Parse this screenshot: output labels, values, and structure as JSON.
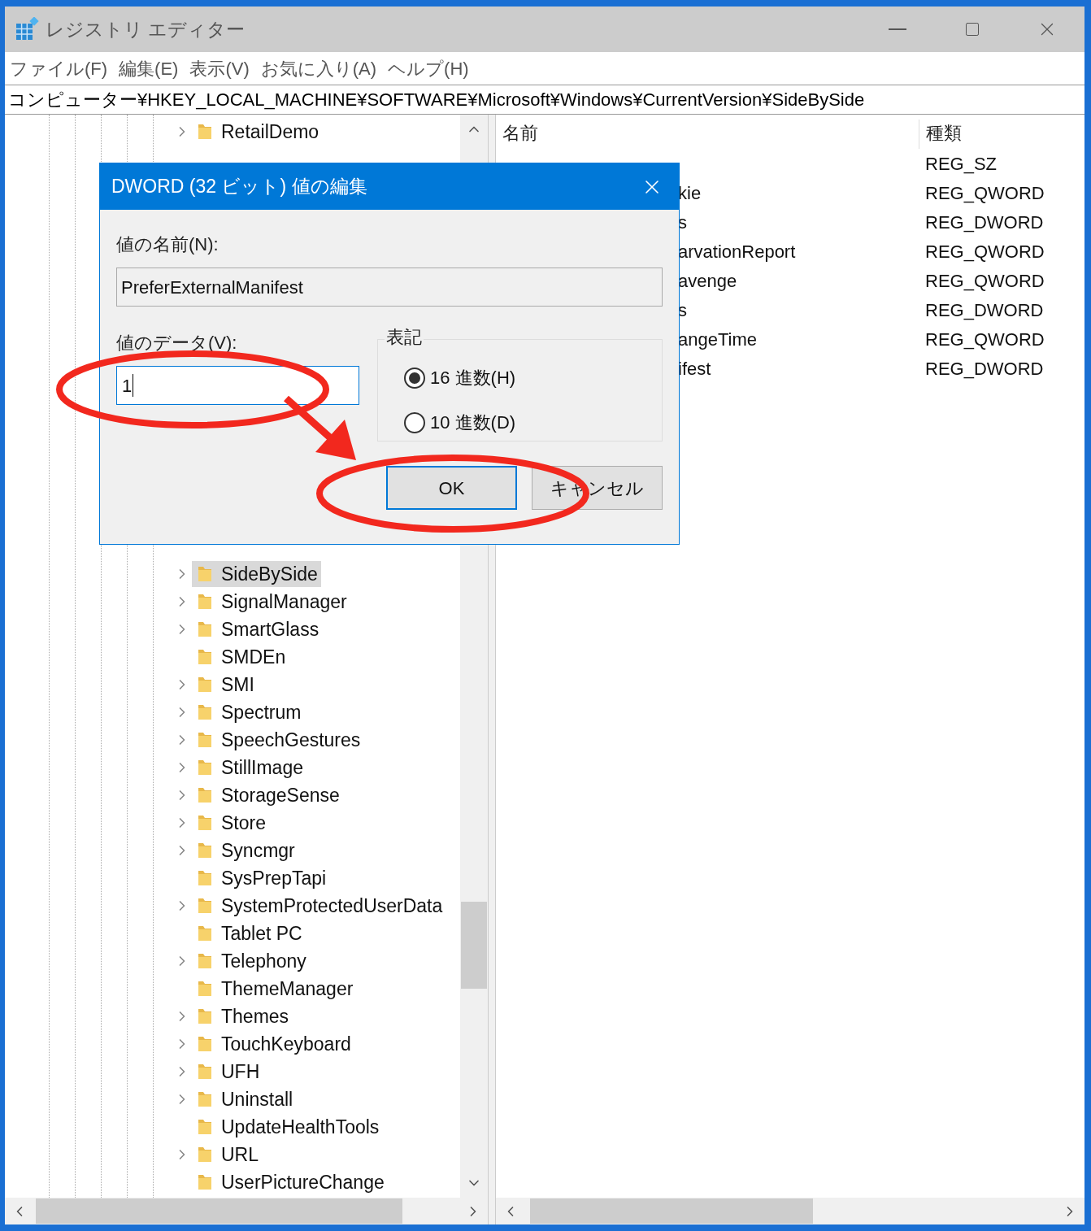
{
  "window": {
    "title": "レジストリ エディター"
  },
  "menu": [
    "ファイル(F)",
    "編集(E)",
    "表示(V)",
    "お気に入り(A)",
    "ヘルプ(H)"
  ],
  "address_bar": {
    "value": "コンピューター¥HKEY_LOCAL_MACHINE¥SOFTWARE¥Microsoft¥Windows¥CurrentVersion¥SideBySide"
  },
  "tree": {
    "items_top": [
      {
        "label": "RetailDemo",
        "expandable": true,
        "selected": false
      }
    ],
    "items_bottom": [
      {
        "label": "SideBySide",
        "expandable": true,
        "selected": true
      },
      {
        "label": "SignalManager",
        "expandable": true,
        "selected": false
      },
      {
        "label": "SmartGlass",
        "expandable": true,
        "selected": false
      },
      {
        "label": "SMDEn",
        "expandable": false,
        "selected": false
      },
      {
        "label": "SMI",
        "expandable": true,
        "selected": false
      },
      {
        "label": "Spectrum",
        "expandable": true,
        "selected": false
      },
      {
        "label": "SpeechGestures",
        "expandable": true,
        "selected": false
      },
      {
        "label": "StillImage",
        "expandable": true,
        "selected": false
      },
      {
        "label": "StorageSense",
        "expandable": true,
        "selected": false
      },
      {
        "label": "Store",
        "expandable": true,
        "selected": false
      },
      {
        "label": "Syncmgr",
        "expandable": true,
        "selected": false
      },
      {
        "label": "SysPrepTapi",
        "expandable": false,
        "selected": false
      },
      {
        "label": "SystemProtectedUserData",
        "expandable": true,
        "selected": false
      },
      {
        "label": "Tablet PC",
        "expandable": false,
        "selected": false
      },
      {
        "label": "Telephony",
        "expandable": true,
        "selected": false
      },
      {
        "label": "ThemeManager",
        "expandable": false,
        "selected": false
      },
      {
        "label": "Themes",
        "expandable": true,
        "selected": false
      },
      {
        "label": "TouchKeyboard",
        "expandable": true,
        "selected": false
      },
      {
        "label": "UFH",
        "expandable": true,
        "selected": false
      },
      {
        "label": "Uninstall",
        "expandable": true,
        "selected": false
      },
      {
        "label": "UpdateHealthTools",
        "expandable": false,
        "selected": false
      },
      {
        "label": "URL",
        "expandable": true,
        "selected": false
      },
      {
        "label": "UserPictureChange",
        "expandable": false,
        "selected": false
      }
    ]
  },
  "values_list": {
    "columns": [
      "名前",
      "種類"
    ],
    "rows": [
      {
        "type": "REG_SZ"
      },
      {
        "name": "kie",
        "type": "REG_QWORD"
      },
      {
        "name": "s",
        "type": "REG_DWORD"
      },
      {
        "name": "arvationReport",
        "type": "REG_QWORD"
      },
      {
        "name": "avenge",
        "type": "REG_QWORD"
      },
      {
        "name": "s",
        "type": "REG_DWORD"
      },
      {
        "name": "angeTime",
        "type": "REG_QWORD"
      },
      {
        "name": "ifest",
        "type": "REG_DWORD"
      }
    ]
  },
  "dialog": {
    "title": "DWORD (32 ビット) 値の編集",
    "name_label": "値の名前(N):",
    "name_value": "PreferExternalManifest",
    "data_label": "値のデータ(V):",
    "data_value": "1",
    "base_group": {
      "label": "表記",
      "options": [
        {
          "label": "16 進数(H)",
          "selected": true
        },
        {
          "label": "10 進数(D)",
          "selected": false
        }
      ]
    },
    "buttons": [
      {
        "label": "OK",
        "default": true
      },
      {
        "label": "キャンセル",
        "default": false
      }
    ]
  }
}
